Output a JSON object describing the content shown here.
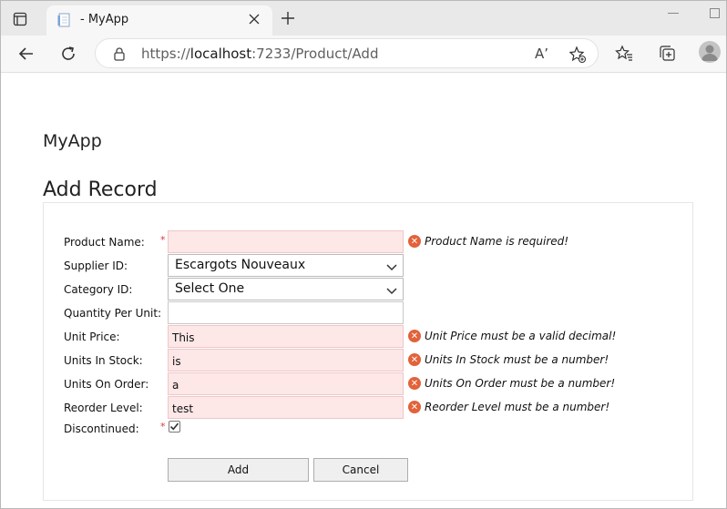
{
  "browser": {
    "tab_title": "- MyApp",
    "url": {
      "scheme": "https://",
      "host": "localhost",
      "port": ":7233",
      "path": "/Product/Add"
    },
    "read_aloud_label": "Aʼ"
  },
  "app": {
    "brand": "MyApp",
    "page_title": "Add Record"
  },
  "form": {
    "fields": [
      {
        "label": "Product Name:",
        "required": true,
        "value": "",
        "invalid": true,
        "error": "Product Name is required!"
      },
      {
        "label": "Supplier ID:",
        "type": "select",
        "value": "Escargots Nouveaux"
      },
      {
        "label": "Category ID:",
        "type": "select",
        "value": "Select One"
      },
      {
        "label": "Quantity Per Unit:",
        "value": ""
      },
      {
        "label": "Unit Price:",
        "value": "This",
        "invalid": true,
        "error": "Unit Price must be a valid decimal!"
      },
      {
        "label": "Units In Stock:",
        "value": "is",
        "invalid": true,
        "error": "Units In Stock must be a number!"
      },
      {
        "label": "Units On Order:",
        "value": "a",
        "invalid": true,
        "error": "Units On Order must be a number!"
      },
      {
        "label": "Reorder Level:",
        "value": "test",
        "invalid": true,
        "error": "Reorder Level must be a number!"
      }
    ],
    "discontinued": {
      "label": "Discontinued:",
      "required": true,
      "checked": true
    },
    "required_marker": "*",
    "add_label": "Add",
    "cancel_label": "Cancel"
  },
  "colors": {
    "error_icon": "#e2623a",
    "invalid_bg": "#fde7e7"
  }
}
